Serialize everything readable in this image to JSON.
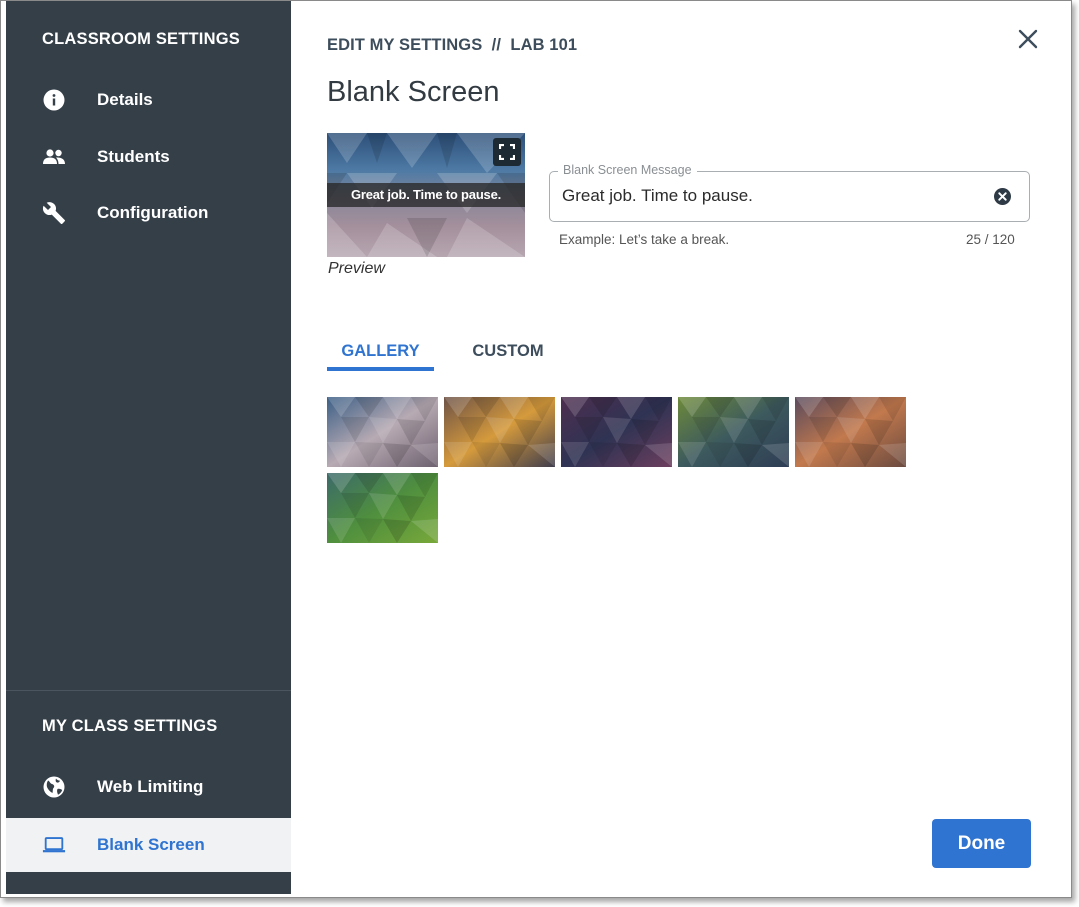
{
  "sidebar": {
    "classroom_header": "CLASSROOM SETTINGS",
    "classroom_items": [
      {
        "label": "Details",
        "icon": "info-icon"
      },
      {
        "label": "Students",
        "icon": "people-icon"
      },
      {
        "label": "Configuration",
        "icon": "wrench-icon"
      }
    ],
    "my_class_header": "MY CLASS SETTINGS",
    "my_class_items": [
      {
        "label": "Web Limiting",
        "icon": "globe-icon"
      },
      {
        "label": "Blank Screen",
        "icon": "laptop-icon",
        "active": true
      }
    ]
  },
  "header": {
    "breadcrumb": "EDIT MY SETTINGS  //  LAB 101",
    "title": "Blank Screen",
    "close_icon": "close-icon"
  },
  "preview": {
    "message": "Great job. Time to pause.",
    "caption": "Preview",
    "fullscreen_icon": "fullscreen-icon"
  },
  "message_field": {
    "label": "Blank Screen Message",
    "value": "Great job. Time to pause.",
    "helper": "Example: Let’s take a break.",
    "counter": "25 / 120",
    "clear_icon": "clear-circle-icon"
  },
  "tabs": [
    {
      "label": "GALLERY",
      "active": true
    },
    {
      "label": "CUSTOM",
      "active": false
    }
  ],
  "gallery": [
    {
      "name": "blue-pink",
      "colors": [
        "#3c5f86",
        "#b7aab3",
        "#6e6170"
      ]
    },
    {
      "name": "brown-gold",
      "colors": [
        "#6d5247",
        "#d59a3c",
        "#3f3d4d"
      ]
    },
    {
      "name": "purple-navy",
      "colors": [
        "#4e2e4f",
        "#2f3353",
        "#6d3e5e"
      ]
    },
    {
      "name": "green-olive",
      "colors": [
        "#6e8a3a",
        "#3d5a5e",
        "#2e3d55"
      ]
    },
    {
      "name": "sunset",
      "colors": [
        "#5a4a5d",
        "#c2794d",
        "#6a4a40"
      ]
    },
    {
      "name": "green-teal",
      "colors": [
        "#3c6a6a",
        "#4f8f3e",
        "#78a83a"
      ]
    }
  ],
  "footer": {
    "done_label": "Done"
  },
  "colors": {
    "sidebar_bg": "#343f48",
    "accent": "#2f74d0",
    "text_dark": "#3d4d5c"
  }
}
